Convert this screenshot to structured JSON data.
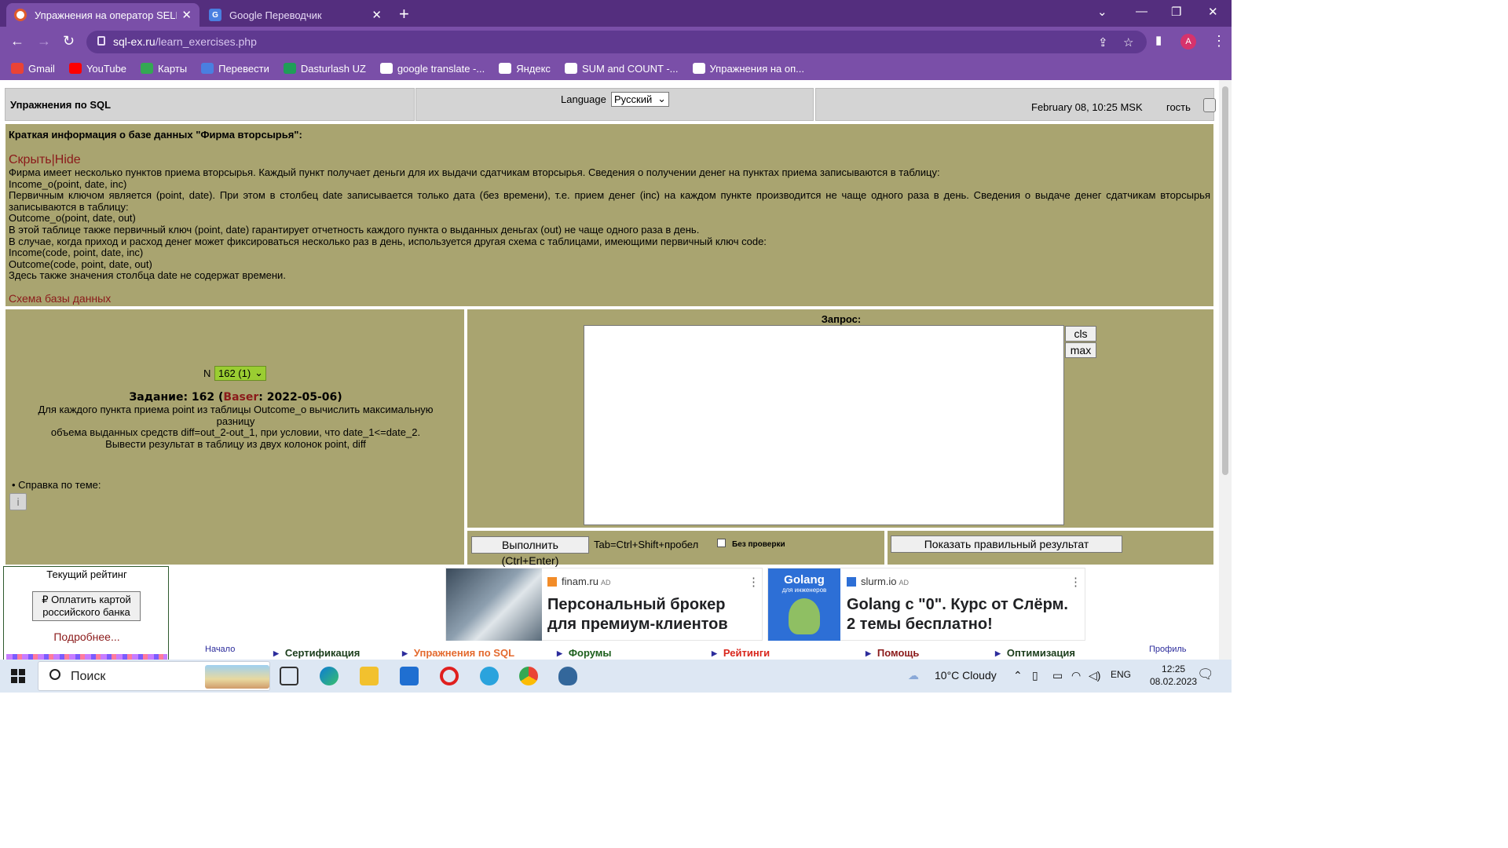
{
  "browser": {
    "tabs": [
      {
        "title": "Упражнения на оператор SELECT",
        "active": true,
        "favicon": "sqlex-icon"
      },
      {
        "title": "Google Переводчик",
        "active": false,
        "favicon": "google-translate-icon"
      }
    ],
    "url_host": "sql-ex.ru",
    "url_path": "/learn_exercises.php",
    "profile_initial": "A",
    "bookmarks": [
      {
        "label": "Gmail",
        "icon": "gmail-icon",
        "color": "#ea4335"
      },
      {
        "label": "YouTube",
        "icon": "youtube-icon",
        "color": "#ff0000"
      },
      {
        "label": "Карты",
        "icon": "maps-icon",
        "color": "#34a853"
      },
      {
        "label": "Перевести",
        "icon": "google-translate-icon",
        "color": "#4a7fe0"
      },
      {
        "label": "Dasturlash UZ",
        "icon": "dasturlash-icon",
        "color": "#1f9e58"
      },
      {
        "label": "google translate -...",
        "icon": "google-icon",
        "color": "#ffffff"
      },
      {
        "label": "Яндекс",
        "icon": "yandex-icon",
        "color": "#ffffff"
      },
      {
        "label": "SUM and COUNT -...",
        "icon": "sqlex-icon",
        "color": "#ffffff"
      },
      {
        "label": "Упражнения на оп...",
        "icon": "sqlex-icon",
        "color": "#ffffff"
      }
    ]
  },
  "header": {
    "title": "Упражнения по SQL",
    "language_label": "Language",
    "language_value": "Русский",
    "datetime": "February 08, 10:25 MSK",
    "user": "гость"
  },
  "info": {
    "heading": "Краткая информация о базе данных \"Фирма вторсырья\":",
    "hide_link": "Скрыть|Hide",
    "lines": [
      "Фирма имеет несколько пунктов приема вторсырья. Каждый пункт получает деньги для их выдачи сдатчикам вторсырья. Сведения о получении денег на пунктах приема записываются в таблицу:",
      "Income_o(point, date, inc)",
      "Первичным ключом является (point, date). При этом в столбец date записывается только дата (без времени), т.е. прием денег (inc) на каждом пункте производится не чаще одного раза в день. Сведения о выдаче денег сдатчикам вторсырья записываются в таблицу:",
      "Outcome_o(point, date, out)",
      "В этой таблице также первичный ключ (point, date) гарантирует отчетность каждого пункта о выданных деньгах (out) не чаще одного раза в день.",
      "В случае, когда приход и расход денег может фиксироваться несколько раз в день, используется другая схема с таблицами, имеющими первичный ключ code:",
      "Income(code, point, date, inc)",
      "Outcome(code, point, date, out)",
      "Здесь также значения столбца date не содержат времени."
    ],
    "schema_link": "Схема базы данных"
  },
  "task": {
    "n_label": "N",
    "n_value": "162 (1)",
    "title_prefix": "Задание: 162 (",
    "title_author": "Baser",
    "title_suffix": ": 2022-05-06)",
    "text_lines": [
      "Для каждого пункта приема point из таблицы Outcome_o вычислить максимальную разницу",
      "объема выданных средств diff=out_2-out_1, при условии, что date_1<=date_2.",
      "Вывести результат в таблицу из двух колонок point, diff"
    ],
    "help_label": "• Справка по теме:"
  },
  "query": {
    "label": "Запрос:",
    "value": "",
    "cls_label": "cls",
    "max_label": "max",
    "execute_label": "Выполнить (Ctrl+Enter)",
    "tab_hint": "Tab=Ctrl+Shift+пробел",
    "no_check_label": "Без проверки",
    "no_check_checked": false,
    "show_result_label": "Показать правильный результат"
  },
  "rating": {
    "title": "Текущий рейтинг",
    "pay_label": "₽ Оплатить картой российского банка",
    "more_link": "Подробнее..."
  },
  "ads": [
    {
      "source": "finam.ru",
      "tag": "AD",
      "headline": "Персональный брокер для премиум-клиентов"
    },
    {
      "source": "slurm.io",
      "tag": "AD",
      "headline": "Golang с \"0\". Курс от Слёрм. 2 темы бесплатно!",
      "image_title": "Golang",
      "image_subtitle": "для инженеров"
    }
  ],
  "site_nav": {
    "home": "Начало",
    "profile": "Профиль",
    "items": [
      {
        "label": "Сертификация",
        "color": "#1b3d1b"
      },
      {
        "label": "Упражнения по SQL",
        "color": "#e46a2e"
      },
      {
        "label": "Форумы",
        "color": "#1b5e1b"
      },
      {
        "label": "Рейтинги",
        "color": "#d9261c"
      },
      {
        "label": "Помощь",
        "color": "#8b1a1a"
      },
      {
        "label": "Оптимизация",
        "color": "#1b3d1b"
      }
    ]
  },
  "taskbar": {
    "search_placeholder": "Поиск",
    "weather": "10°C  Cloudy",
    "lang": "ENG",
    "time": "12:25",
    "date": "08.02.2023"
  }
}
